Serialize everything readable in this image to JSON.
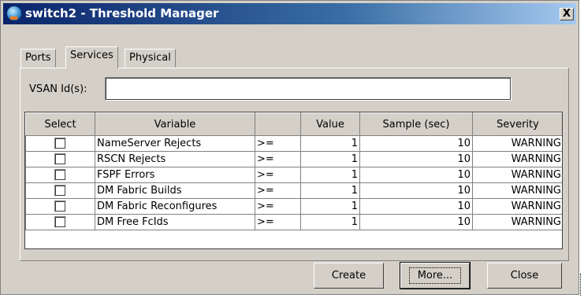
{
  "window": {
    "title": "switch2 - Threshold Manager",
    "close_symbol": "X",
    "icon": "app-globe-icon"
  },
  "tabs": [
    {
      "label": "Ports",
      "active": false
    },
    {
      "label": "Services",
      "active": true
    },
    {
      "label": "Physical",
      "active": false
    }
  ],
  "vsan": {
    "label": "VSAN Id(s):",
    "value": ""
  },
  "table": {
    "columns": [
      "Select",
      "Variable",
      "",
      "Value",
      "Sample (sec)",
      "Severity"
    ],
    "rows": [
      {
        "select": false,
        "variable": "NameServer Rejects",
        "op": ">=",
        "value": "1",
        "sample": "10",
        "severity": "WARNING"
      },
      {
        "select": false,
        "variable": "RSCN Rejects",
        "op": ">=",
        "value": "1",
        "sample": "10",
        "severity": "WARNING"
      },
      {
        "select": false,
        "variable": "FSPF Errors",
        "op": ">=",
        "value": "1",
        "sample": "10",
        "severity": "WARNING"
      },
      {
        "select": false,
        "variable": "DM Fabric Builds",
        "op": ">=",
        "value": "1",
        "sample": "10",
        "severity": "WARNING"
      },
      {
        "select": false,
        "variable": "DM Fabric Reconfigures",
        "op": ">=",
        "value": "1",
        "sample": "10",
        "severity": "WARNING"
      },
      {
        "select": false,
        "variable": "DM Free FcIds",
        "op": ">=",
        "value": "1",
        "sample": "10",
        "severity": "WARNING"
      }
    ]
  },
  "buttons": {
    "create": "Create",
    "more": "More...",
    "close": "Close"
  }
}
